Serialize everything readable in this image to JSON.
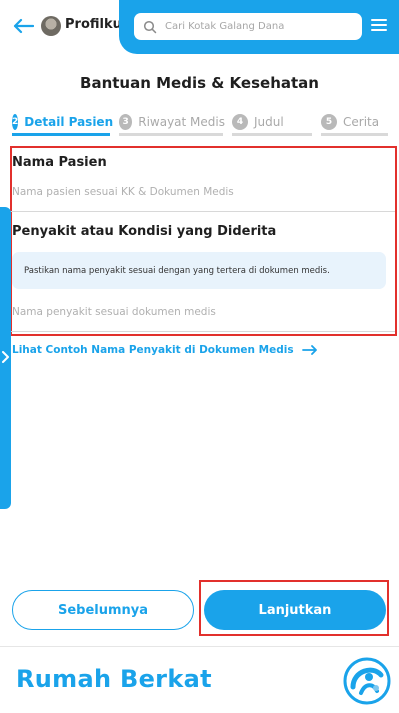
{
  "header": {
    "profile_label": "Profilku",
    "search_placeholder": "Cari Kotak Galang Dana",
    "accent": "#1aa3ea"
  },
  "page": {
    "title": "Bantuan Medis & Kesehatan"
  },
  "steps": [
    {
      "num": "2",
      "label": "Detail Pasien",
      "active": true
    },
    {
      "num": "3",
      "label": "Riwayat Medis",
      "active": false
    },
    {
      "num": "4",
      "label": "Judul",
      "active": false
    },
    {
      "num": "5",
      "label": "Cerita",
      "active": false
    }
  ],
  "form": {
    "patient_name_label": "Nama Pasien",
    "patient_name_placeholder": "Nama pasien sesuai KK & Dokumen Medis",
    "patient_name_value": "",
    "illness_label": "Penyakit atau Kondisi yang Diderita",
    "illness_info": "Pastikan nama penyakit sesuai dengan yang tertera di dokumen medis.",
    "illness_placeholder": "Nama penyakit sesuai dokumen medis",
    "illness_value": ""
  },
  "example_link": "Lihat Contoh Nama Penyakit di Dokumen Medis",
  "buttons": {
    "prev": "Sebelumnya",
    "next": "Lanjutkan"
  },
  "footer": {
    "brand": "Rumah Berkat"
  },
  "icons": {
    "back": "arrow-left-icon",
    "search": "search-icon",
    "menu": "hamburger-menu-icon",
    "side": "chevron-right-icon",
    "link_arrow": "arrow-right-icon"
  }
}
